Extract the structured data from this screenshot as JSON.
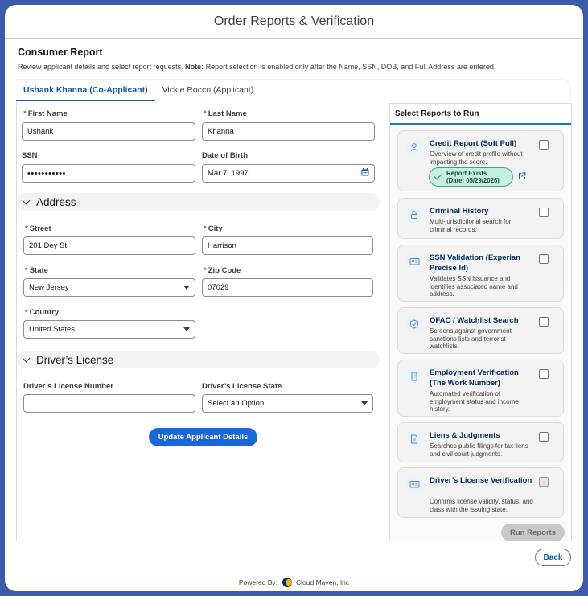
{
  "modal": {
    "title": "Order Reports & Verification"
  },
  "intro": {
    "title": "Consumer Report",
    "desc_prefix": "Review applicant details and select report requests.",
    "note_label": "Note:",
    "note_text": "Report selection is enabled only after the Name, SSN, DOB, and Full Address are entered."
  },
  "tabs": [
    {
      "label": "Ushank Khanna (Co-Applicant)",
      "active": true
    },
    {
      "label": "Vickie Rocco (Applicant)",
      "active": false
    }
  ],
  "form": {
    "first_name": {
      "label": "First Name",
      "value": "Ushank"
    },
    "last_name": {
      "label": "Last Name",
      "value": "Khanna"
    },
    "ssn": {
      "label": "SSN",
      "value": "•••••••••••"
    },
    "dob": {
      "label": "Date of Birth",
      "value": "Mar 7, 1997"
    },
    "address_section": "Address",
    "street": {
      "label": "Street",
      "value": "201 Dey St"
    },
    "city": {
      "label": "City",
      "value": "Harrison"
    },
    "state": {
      "label": "State",
      "value": "New Jersey"
    },
    "zip": {
      "label": "Zip Code",
      "value": "07029"
    },
    "country": {
      "label": "Country",
      "value": "United States"
    },
    "license_section": "Driver’s License",
    "license_number": {
      "label": "Driver’s License Number",
      "value": ""
    },
    "license_state": {
      "label": "Driver’s License State",
      "value": "Select an Option"
    },
    "required_marker": "*",
    "update_button": "Update Applicant Details"
  },
  "reports": {
    "title": "Select Reports to Run",
    "items": [
      {
        "title": "Credit Report (Soft Pull)",
        "desc": "Overview of credit profile without impacting the score.",
        "icon": "person-icon",
        "badge_line1": "Report Exists",
        "badge_line2": "(Date: 05/29/2026)"
      },
      {
        "title": "Criminal History",
        "desc": "Multi-jurisdictional search for criminal records.",
        "icon": "lock-icon"
      },
      {
        "title": "SSN Validation (Experian Precise Id)",
        "desc": "Validates SSN issuance and identifies associated name and address.",
        "icon": "id-card-icon"
      },
      {
        "title": "OFAC / Watchlist Search",
        "desc": "Screens against government sanctions lists and terrorist watchlists.",
        "icon": "shield-icon"
      },
      {
        "title": "Employment Verification (The Work Number)",
        "desc": "Automated verification of employment status and income history.",
        "icon": "building-icon"
      },
      {
        "title": "Liens & Judgments",
        "desc": "Searches public filings for tax liens and civil court judgments.",
        "icon": "document-icon"
      },
      {
        "title": "Driver’s License Verification",
        "desc": "Confirms license validity, status, and class with the issuing state.",
        "icon": "license-icon"
      }
    ],
    "run_button": "Run Reports"
  },
  "back_button": "Back",
  "footer": {
    "powered_by": "Powered By:",
    "company": "Cloud Maven, Inc"
  }
}
